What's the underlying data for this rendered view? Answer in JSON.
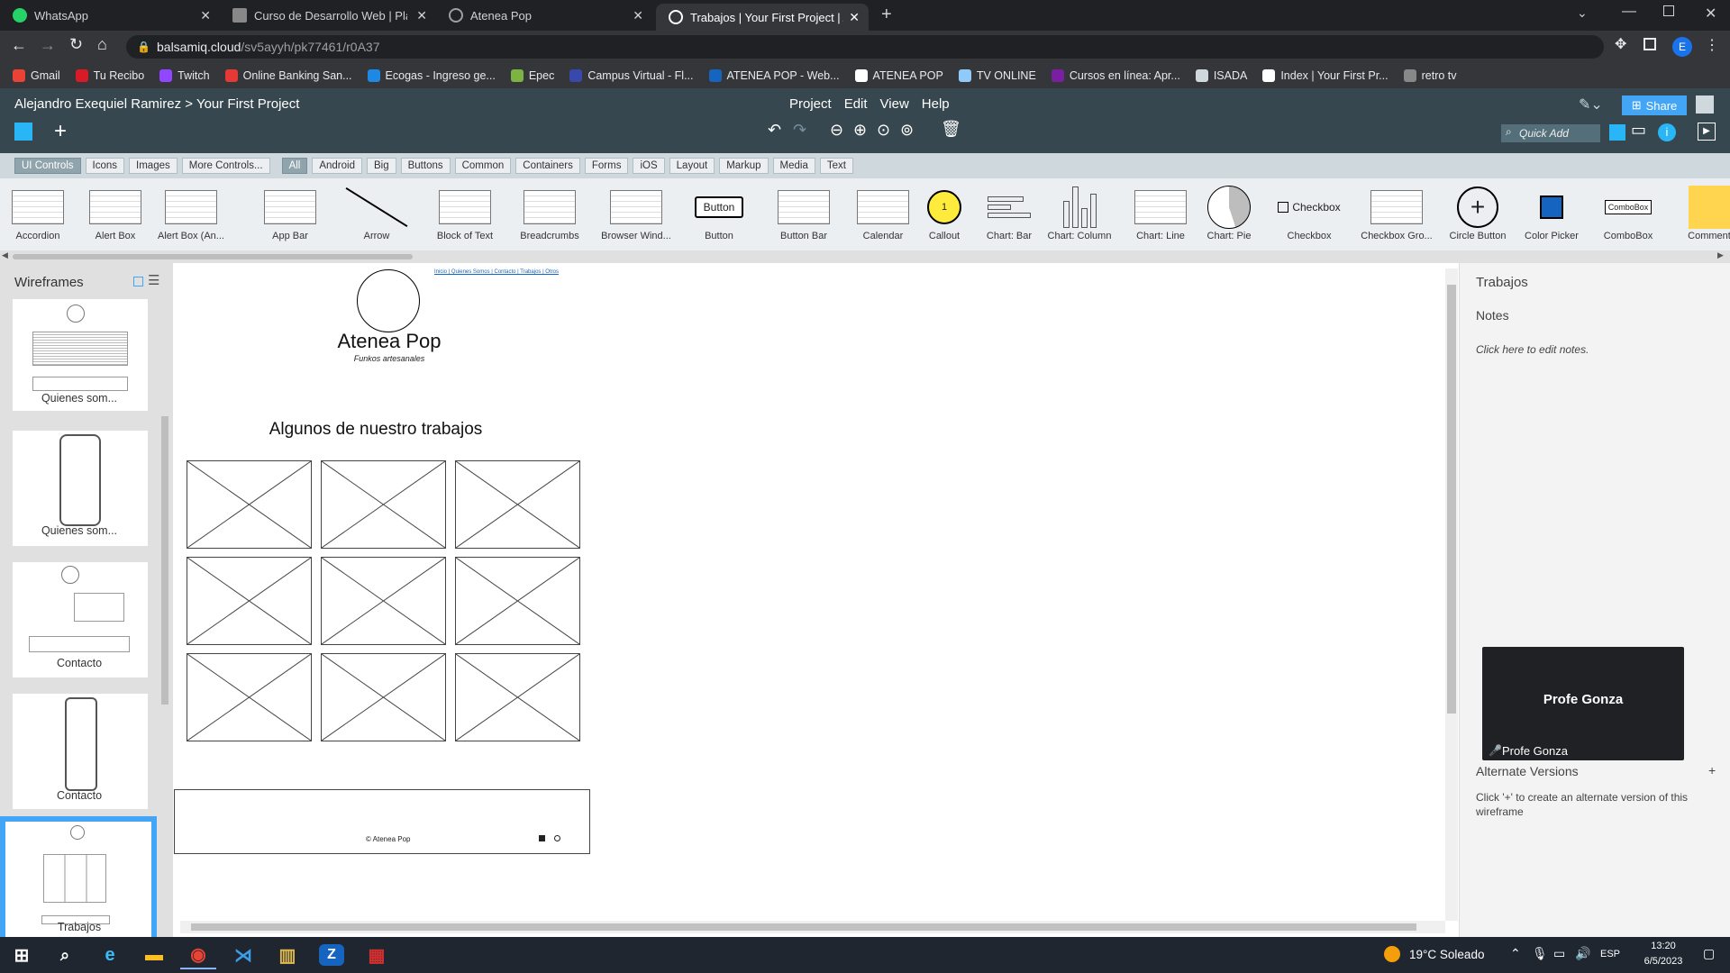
{
  "browser": {
    "tabs": [
      {
        "label": "WhatsApp",
        "color": "#25d366"
      },
      {
        "label": "Curso de Desarrollo Web | Platafo",
        "color": "#888888"
      },
      {
        "label": "Atenea Pop",
        "color": "#9aa0a6"
      },
      {
        "label": "Trabajos | Your First Project | Alej",
        "color": "#ffffff"
      }
    ],
    "url_host": "balsamiq.cloud",
    "url_path": "/sv5ayyh/pk77461/r0A37",
    "profile_initial": "E",
    "bookmarks": [
      {
        "label": "Gmail",
        "color": "#ea4335"
      },
      {
        "label": "Tu Recibo",
        "color": "#d81b27"
      },
      {
        "label": "Twitch",
        "color": "#9146ff"
      },
      {
        "label": "Online Banking San...",
        "color": "#e53935"
      },
      {
        "label": "Ecogas - Ingreso ge...",
        "color": "#1e88e5"
      },
      {
        "label": "Epec",
        "color": "#7cb342"
      },
      {
        "label": "Campus Virtual - Fl...",
        "color": "#3949ab"
      },
      {
        "label": "ATENEA POP - Web...",
        "color": "#1565c0"
      },
      {
        "label": "ATENEA POP",
        "color": "#ffffff"
      },
      {
        "label": "TV ONLINE",
        "color": "#90caf9"
      },
      {
        "label": "Cursos en línea: Apr...",
        "color": "#7b1fa2"
      },
      {
        "label": "ISADA",
        "color": "#cfd8dc"
      },
      {
        "label": "Index | Your First Pr...",
        "color": "#ffffff"
      },
      {
        "label": "retro tv",
        "color": "#888888"
      }
    ]
  },
  "app": {
    "breadcrumb_owner": "Alejandro Exequiel Ramirez",
    "breadcrumb_sep": ">",
    "project_name": "Your First Project",
    "menus": [
      "Project",
      "Edit",
      "View",
      "Help"
    ],
    "share_label": "Share",
    "quick_add_placeholder": "Quick Add"
  },
  "library": {
    "tabs": [
      "UI Controls",
      "Icons",
      "Images",
      "More Controls...",
      "All",
      "Android",
      "Big",
      "Buttons",
      "Common",
      "Containers",
      "Forms",
      "iOS",
      "Layout",
      "Markup",
      "Media",
      "Text"
    ],
    "items": [
      "Accordion",
      "Alert Box",
      "Alert Box (An...",
      "App Bar",
      "Arrow",
      "Block of Text",
      "Breadcrumbs",
      "Browser Wind...",
      "Button",
      "Button Bar",
      "Calendar",
      "Callout",
      "Chart: Bar",
      "Chart: Column",
      "Chart: Line",
      "Chart: Pie",
      "Checkbox",
      "Checkbox Gro...",
      "Circle Button",
      "Color Picker",
      "ComboBox",
      "Comment"
    ],
    "button_preview": "Button",
    "checkbox_preview": "Checkbox",
    "combobox_preview": "ComboBox",
    "callout_preview": "1"
  },
  "wireframes": {
    "title": "Wireframes",
    "items": [
      {
        "name": "Quienes som..."
      },
      {
        "name": "Quienes som..."
      },
      {
        "name": "Contacto"
      },
      {
        "name": "Contacto"
      },
      {
        "name": "Trabajos"
      }
    ]
  },
  "canvas": {
    "nav_links": "Inicio | Quienes Somos | Contacto | Trabajos | Otros",
    "logo_title": "Atenea Pop",
    "logo_subtitle": "Funkos artesanales",
    "heading": "Algunos de nuestro trabajos",
    "footer_text": "© Atenea Pop",
    "image_grid": {
      "rows": 3,
      "cols": 3
    }
  },
  "right_panel": {
    "title": "Trabajos",
    "notes_label": "Notes",
    "notes_placeholder": "Click here to edit notes.",
    "video_name": "Profe Gonza",
    "video_caption": "Profe Gonza",
    "alt_versions_label": "Alternate Versions",
    "alt_versions_add": "+",
    "alt_versions_hint": "Click '+' to create an alternate version of this wireframe"
  },
  "taskbar": {
    "weather": "19°C  Soleado",
    "lang": "ESP",
    "time": "13:20",
    "date": "6/5/2023"
  }
}
